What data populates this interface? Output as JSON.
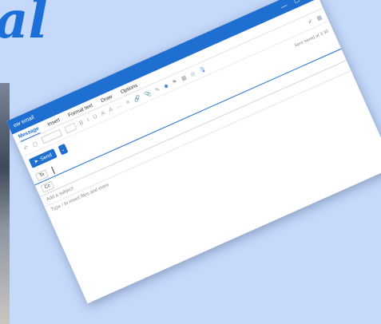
{
  "background": {
    "script_text": "al",
    "color": "#c5d9fb",
    "script_color": "#1b6fd6"
  },
  "window": {
    "title": "ew email",
    "controls": {
      "minimize": "—",
      "maximize": "☐",
      "close": "✕"
    },
    "tabs": [
      {
        "label": "Message",
        "active": true
      },
      {
        "label": "Insert",
        "active": false
      },
      {
        "label": "Format text",
        "active": false
      },
      {
        "label": "Draw",
        "active": false
      },
      {
        "label": "Options",
        "active": false
      }
    ],
    "toolbar": {
      "icons": [
        "undo-icon",
        "clipboard-icon",
        "bold-icon",
        "italic-icon",
        "underline-icon",
        "highlight-icon",
        "font-color-icon",
        "more-icon",
        "bullets-icon",
        "link-icon",
        "attach-icon",
        "signature-icon",
        "tag-icon",
        "flag-icon",
        "grid-icon",
        "sensitivity-icon",
        "dictate-icon",
        "editor-icon",
        "apps-icon"
      ],
      "glyphs": [
        "B",
        "I",
        "U",
        "A",
        "A",
        "⋯",
        "≡",
        "🔗",
        "📎",
        "✎",
        "◆",
        "⚑",
        "▦",
        "◎",
        "🎙",
        "✔",
        "▦"
      ]
    },
    "send": {
      "label": "Send",
      "chevron": "⌄",
      "send_later": "Sent saved at 3:30"
    },
    "to_label": "To",
    "cc_label": "Cc",
    "subject_placeholder": "Add a subject",
    "body_hint": "Type / to insert files and more",
    "accent": "#1e6fd0"
  }
}
